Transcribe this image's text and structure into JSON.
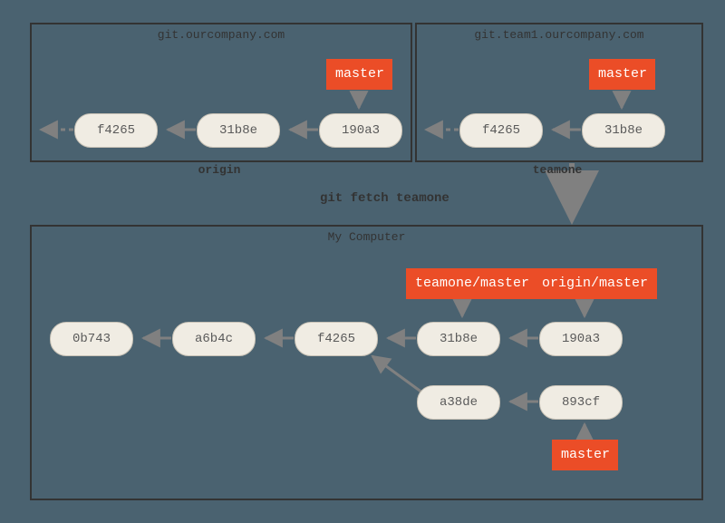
{
  "colors": {
    "background": "#4a6270",
    "commit_fill": "#f0ece3",
    "commit_stroke": "#c8c2b6",
    "branch_fill": "#eb4d27",
    "panel_stroke": "#333",
    "arrow": "#808080"
  },
  "command": "git fetch teamone",
  "origin": {
    "title": "git.ourcompany.com",
    "label": "origin",
    "branch": "master",
    "commits": [
      "f4265",
      "31b8e",
      "190a3"
    ]
  },
  "teamone": {
    "title": "git.team1.ourcompany.com",
    "label": "teamone",
    "branch": "master",
    "commits": [
      "f4265",
      "31b8e"
    ]
  },
  "local": {
    "title": "My Computer",
    "branches": {
      "teamone_master": "teamone/master",
      "origin_master": "origin/master",
      "master": "master"
    },
    "commits_top": [
      "0b743",
      "a6b4c",
      "f4265",
      "31b8e",
      "190a3"
    ],
    "commits_bottom": [
      "a38de",
      "893cf"
    ]
  }
}
